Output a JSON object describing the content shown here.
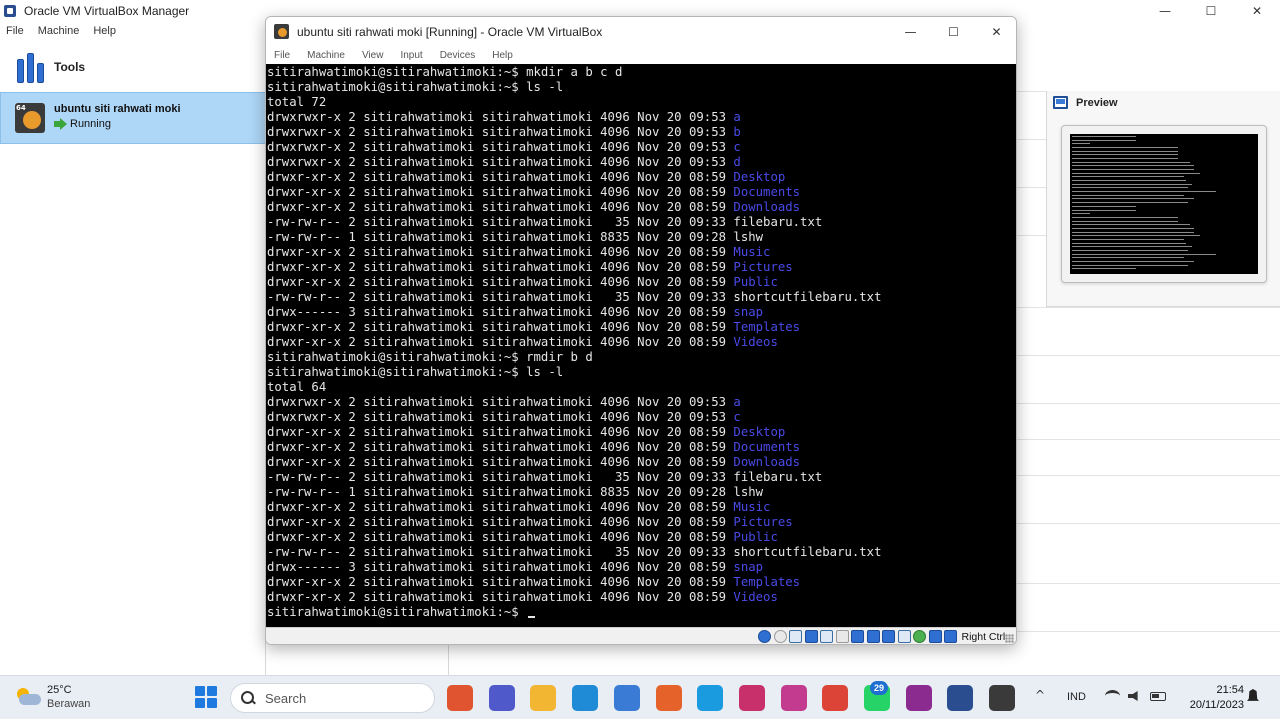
{
  "manager": {
    "title": "Oracle VM VirtualBox Manager",
    "menu": [
      "File",
      "Machine",
      "Help"
    ],
    "window_buttons": {
      "minimize": "—",
      "maximize": "☐",
      "close": "✕"
    },
    "tools_label": "Tools",
    "vm": {
      "badge": "64",
      "name": "ubuntu siti rahwati moki",
      "state": "Running"
    },
    "preview_title": "Preview"
  },
  "vm_window": {
    "title": "ubuntu siti rahwati moki [Running] - Oracle VM VirtualBox",
    "menu": [
      "File",
      "Machine",
      "View",
      "Input",
      "Devices",
      "Help"
    ],
    "window_buttons": {
      "minimize": "—",
      "maximize": "☐",
      "close": "✕"
    },
    "host_key": "Right Ctrl"
  },
  "colors": {
    "directory_text": "#4a4ae8",
    "terminal_bg": "#000000",
    "vm_selected": "#aed6f7"
  },
  "terminal": {
    "lines": [
      {
        "type": "cmd",
        "prompt": "sitirahwatimoki@sitirahwatimoki:~$ ",
        "command": "mkdir a b c d"
      },
      {
        "type": "cmd",
        "prompt": "sitirahwatimoki@sitirahwatimoki:~$ ",
        "command": "ls -l"
      },
      {
        "type": "text",
        "text": "total 72"
      },
      {
        "type": "entry",
        "meta": "drwxrwxr-x 2 sitirahwatimoki sitirahwatimoki 4096 Nov 20 09:53 ",
        "name": "a",
        "dir": true
      },
      {
        "type": "entry",
        "meta": "drwxrwxr-x 2 sitirahwatimoki sitirahwatimoki 4096 Nov 20 09:53 ",
        "name": "b",
        "dir": true
      },
      {
        "type": "entry",
        "meta": "drwxrwxr-x 2 sitirahwatimoki sitirahwatimoki 4096 Nov 20 09:53 ",
        "name": "c",
        "dir": true
      },
      {
        "type": "entry",
        "meta": "drwxrwxr-x 2 sitirahwatimoki sitirahwatimoki 4096 Nov 20 09:53 ",
        "name": "d",
        "dir": true
      },
      {
        "type": "entry",
        "meta": "drwxr-xr-x 2 sitirahwatimoki sitirahwatimoki 4096 Nov 20 08:59 ",
        "name": "Desktop",
        "dir": true
      },
      {
        "type": "entry",
        "meta": "drwxr-xr-x 2 sitirahwatimoki sitirahwatimoki 4096 Nov 20 08:59 ",
        "name": "Documents",
        "dir": true
      },
      {
        "type": "entry",
        "meta": "drwxr-xr-x 2 sitirahwatimoki sitirahwatimoki 4096 Nov 20 08:59 ",
        "name": "Downloads",
        "dir": true
      },
      {
        "type": "entry",
        "meta": "-rw-rw-r-- 2 sitirahwatimoki sitirahwatimoki   35 Nov 20 09:33 ",
        "name": "filebaru.txt",
        "dir": false
      },
      {
        "type": "entry",
        "meta": "-rw-rw-r-- 1 sitirahwatimoki sitirahwatimoki 8835 Nov 20 09:28 ",
        "name": "lshw",
        "dir": false
      },
      {
        "type": "entry",
        "meta": "drwxr-xr-x 2 sitirahwatimoki sitirahwatimoki 4096 Nov 20 08:59 ",
        "name": "Music",
        "dir": true
      },
      {
        "type": "entry",
        "meta": "drwxr-xr-x 2 sitirahwatimoki sitirahwatimoki 4096 Nov 20 08:59 ",
        "name": "Pictures",
        "dir": true
      },
      {
        "type": "entry",
        "meta": "drwxr-xr-x 2 sitirahwatimoki sitirahwatimoki 4096 Nov 20 08:59 ",
        "name": "Public",
        "dir": true
      },
      {
        "type": "entry",
        "meta": "-rw-rw-r-- 2 sitirahwatimoki sitirahwatimoki   35 Nov 20 09:33 ",
        "name": "shortcutfilebaru.txt",
        "dir": false
      },
      {
        "type": "entry",
        "meta": "drwx------ 3 sitirahwatimoki sitirahwatimoki 4096 Nov 20 08:59 ",
        "name": "snap",
        "dir": true
      },
      {
        "type": "entry",
        "meta": "drwxr-xr-x 2 sitirahwatimoki sitirahwatimoki 4096 Nov 20 08:59 ",
        "name": "Templates",
        "dir": true
      },
      {
        "type": "entry",
        "meta": "drwxr-xr-x 2 sitirahwatimoki sitirahwatimoki 4096 Nov 20 08:59 ",
        "name": "Videos",
        "dir": true
      },
      {
        "type": "cmd",
        "prompt": "sitirahwatimoki@sitirahwatimoki:~$ ",
        "command": "rmdir b d"
      },
      {
        "type": "cmd",
        "prompt": "sitirahwatimoki@sitirahwatimoki:~$ ",
        "command": "ls -l"
      },
      {
        "type": "text",
        "text": "total 64"
      },
      {
        "type": "entry",
        "meta": "drwxrwxr-x 2 sitirahwatimoki sitirahwatimoki 4096 Nov 20 09:53 ",
        "name": "a",
        "dir": true
      },
      {
        "type": "entry",
        "meta": "drwxrwxr-x 2 sitirahwatimoki sitirahwatimoki 4096 Nov 20 09:53 ",
        "name": "c",
        "dir": true
      },
      {
        "type": "entry",
        "meta": "drwxr-xr-x 2 sitirahwatimoki sitirahwatimoki 4096 Nov 20 08:59 ",
        "name": "Desktop",
        "dir": true
      },
      {
        "type": "entry",
        "meta": "drwxr-xr-x 2 sitirahwatimoki sitirahwatimoki 4096 Nov 20 08:59 ",
        "name": "Documents",
        "dir": true
      },
      {
        "type": "entry",
        "meta": "drwxr-xr-x 2 sitirahwatimoki sitirahwatimoki 4096 Nov 20 08:59 ",
        "name": "Downloads",
        "dir": true
      },
      {
        "type": "entry",
        "meta": "-rw-rw-r-- 2 sitirahwatimoki sitirahwatimoki   35 Nov 20 09:33 ",
        "name": "filebaru.txt",
        "dir": false
      },
      {
        "type": "entry",
        "meta": "-rw-rw-r-- 1 sitirahwatimoki sitirahwatimoki 8835 Nov 20 09:28 ",
        "name": "lshw",
        "dir": false
      },
      {
        "type": "entry",
        "meta": "drwxr-xr-x 2 sitirahwatimoki sitirahwatimoki 4096 Nov 20 08:59 ",
        "name": "Music",
        "dir": true
      },
      {
        "type": "entry",
        "meta": "drwxr-xr-x 2 sitirahwatimoki sitirahwatimoki 4096 Nov 20 08:59 ",
        "name": "Pictures",
        "dir": true
      },
      {
        "type": "entry",
        "meta": "drwxr-xr-x 2 sitirahwatimoki sitirahwatimoki 4096 Nov 20 08:59 ",
        "name": "Public",
        "dir": true
      },
      {
        "type": "entry",
        "meta": "-rw-rw-r-- 2 sitirahwatimoki sitirahwatimoki   35 Nov 20 09:33 ",
        "name": "shortcutfilebaru.txt",
        "dir": false
      },
      {
        "type": "entry",
        "meta": "drwx------ 3 sitirahwatimoki sitirahwatimoki 4096 Nov 20 08:59 ",
        "name": "snap",
        "dir": true
      },
      {
        "type": "entry",
        "meta": "drwxr-xr-x 2 sitirahwatimoki sitirahwatimoki 4096 Nov 20 08:59 ",
        "name": "Templates",
        "dir": true
      },
      {
        "type": "entry",
        "meta": "drwxr-xr-x 2 sitirahwatimoki sitirahwatimoki 4096 Nov 20 08:59 ",
        "name": "Videos",
        "dir": true
      },
      {
        "type": "prompt",
        "prompt": "sitirahwatimoki@sitirahwatimoki:~$ ",
        "command": ""
      }
    ]
  },
  "status_icons": [
    "hard-disk-icon",
    "optical-drive-icon",
    "audio-icon",
    "network-icon",
    "usb-icon",
    "shared-folders-icon",
    "display-icon",
    "recording-icon",
    "video-capture-icon",
    "guest-additions-icon",
    "cpu-icon",
    "mouse-integration-icon",
    "keyboard-icon"
  ],
  "taskbar": {
    "weather": {
      "temp": "25°C",
      "desc": "Berawan"
    },
    "search_placeholder": "Search",
    "apps": [
      {
        "name": "microsoft-365-icon",
        "color": "#e0542f"
      },
      {
        "name": "teams-icon",
        "color": "#5059c9"
      },
      {
        "name": "file-explorer-icon",
        "color": "#f2b632"
      },
      {
        "name": "paint-icon",
        "color": "#1f8bd6"
      },
      {
        "name": "copilot-icon",
        "color": "#3a7bd5"
      },
      {
        "name": "firefox-icon",
        "color": "#e5632a"
      },
      {
        "name": "edge-icon",
        "color": "#1a9be0"
      },
      {
        "name": "snipping-tool-icon",
        "color": "#c7306b"
      },
      {
        "name": "wps-office-icon",
        "color": "#c23b8f"
      },
      {
        "name": "chrome-icon",
        "color": "#db4437"
      },
      {
        "name": "whatsapp-icon",
        "color": "#25d366"
      },
      {
        "name": "winrar-icon",
        "color": "#8b2a8f"
      },
      {
        "name": "virtualbox-icon",
        "color": "#2a4d8f"
      },
      {
        "name": "ubuntu-vm-icon",
        "color": "#3a3a3a"
      }
    ],
    "whatsapp_badge": "29",
    "tray": {
      "chevron": "^",
      "language": "IND"
    },
    "clock": {
      "time": "21:54",
      "date": "20/11/2023"
    }
  }
}
